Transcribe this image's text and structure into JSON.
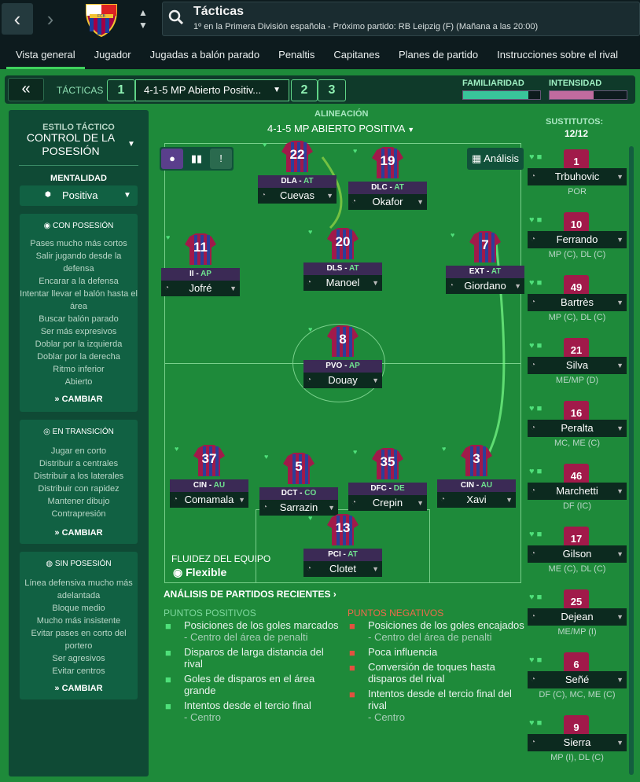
{
  "topbar": {
    "back": "‹",
    "forward": "›",
    "title": "Tácticas",
    "subtitle": "1º en la Primera División española - Próximo partido: RB Leipzig (F) (Mañana a las 20:00)",
    "crest_text": "FCB"
  },
  "tabs": [
    "Vista general",
    "Jugador",
    "Jugadas a balón parado",
    "Penaltis",
    "Capitanes",
    "Planes de partido",
    "Instrucciones sobre el rival"
  ],
  "tactic_header": {
    "collapse": "«",
    "label": "TÁCTICAS",
    "slots": [
      "1",
      "2",
      "3"
    ],
    "selected": "4-1-5 MP Abierto Positiv...",
    "familiaridad": "FAMILIARIDAD",
    "familiaridad_level": 0.85,
    "intensidad": "INTENSIDAD",
    "intensidad_level": 0.57
  },
  "left_panel": {
    "estilo_label": "ESTILO TÁCTICO",
    "estilo_value": "CONTROL DE LA POSESIÓN",
    "mentalidad_label": "MENTALIDAD",
    "mentalidad_value": "Positiva",
    "con_posesion": {
      "title": "CON POSESIÓN",
      "items": [
        "Pases mucho más cortos",
        "Salir jugando desde la defensa",
        "Encarar a la defensa",
        "Intentar llevar el balón hasta el área",
        "Buscar balón parado",
        "Ser más expresivos",
        "Doblar por la izquierda",
        "Doblar por la derecha",
        "Ritmo inferior",
        "Abierto"
      ],
      "button": "CAMBIAR"
    },
    "en_transicion": {
      "title": "EN TRANSICIÓN",
      "items": [
        "Jugar en corto",
        "Distribuir a centrales",
        "Distribuir a los laterales",
        "Distribuir con rapidez",
        "Mantener dibujo",
        "Contrapresión"
      ],
      "button": "CAMBIAR"
    },
    "sin_posesion": {
      "title": "SIN POSESIÓN",
      "items": [
        "Línea defensiva mucho más adelantada",
        "Bloque medio",
        "Mucho más insistente",
        "Evitar pases en corto del portero",
        "Ser agresivos",
        "Evitar centros"
      ],
      "button": "CAMBIAR"
    }
  },
  "pitch": {
    "alineacion": "ALINEACIÓN",
    "formation": "4-1-5 MP ABIERTO POSITIVA",
    "analisis": "Análisis",
    "players": [
      {
        "num": "22",
        "pos": "DLA",
        "duty": "AT",
        "name": "Cuevas"
      },
      {
        "num": "19",
        "pos": "DLC",
        "duty": "AT",
        "name": "Okafor"
      },
      {
        "num": "11",
        "pos": "II",
        "duty": "AP",
        "name": "Jofré"
      },
      {
        "num": "20",
        "pos": "DLS",
        "duty": "AT",
        "name": "Manoel"
      },
      {
        "num": "7",
        "pos": "EXT",
        "duty": "AT",
        "name": "Giordano"
      },
      {
        "num": "8",
        "pos": "PVO",
        "duty": "AP",
        "name": "Douay"
      },
      {
        "num": "37",
        "pos": "CIN",
        "duty": "AU",
        "name": "Comamala"
      },
      {
        "num": "5",
        "pos": "DCT",
        "duty": "CO",
        "name": "Sarrazin"
      },
      {
        "num": "35",
        "pos": "DFC",
        "duty": "DE",
        "name": "Crepin"
      },
      {
        "num": "3",
        "pos": "CIN",
        "duty": "AU",
        "name": "Xavi"
      },
      {
        "num": "13",
        "pos": "PCI",
        "duty": "AT",
        "name": "Clotet"
      }
    ],
    "fluidez_label": "FLUIDEZ DEL EQUIPO",
    "fluidez_value": "Flexible"
  },
  "analysis": {
    "title": "ANÁLISIS DE PARTIDOS RECIENTES",
    "positivos_label": "PUNTOS POSITIVOS",
    "positivos": [
      {
        "text": "Posiciones de los goles marcados",
        "sub": "- Centro del área de penalti"
      },
      {
        "text": "Disparos de larga distancia del rival",
        "sub": ""
      },
      {
        "text": "Goles de disparos en el área grande",
        "sub": ""
      },
      {
        "text": "Intentos desde el tercio final",
        "sub": "- Centro"
      }
    ],
    "negativos_label": "PUNTOS NEGATIVOS",
    "negativos": [
      {
        "text": "Posiciones de los goles encajados",
        "sub": "- Centro del área de penalti"
      },
      {
        "text": "Poca influencia",
        "sub": ""
      },
      {
        "text": "Conversión de toques hasta disparos del rival",
        "sub": ""
      },
      {
        "text": "Intentos desde el tercio final del rival",
        "sub": "- Centro"
      }
    ]
  },
  "subs": {
    "title": "SUSTITUTOS:",
    "count": "12/12",
    "players": [
      {
        "num": "1",
        "name": "Trbuhovic",
        "pos": "POR"
      },
      {
        "num": "10",
        "name": "Ferrando",
        "pos": "MP (C), DL (C)"
      },
      {
        "num": "49",
        "name": "Bartrès",
        "pos": "MP (C), DL (C)"
      },
      {
        "num": "21",
        "name": "Silva",
        "pos": "ME/MP (D)"
      },
      {
        "num": "16",
        "name": "Peralta",
        "pos": "MC, ME (C)"
      },
      {
        "num": "46",
        "name": "Marchetti",
        "pos": "DF (IC)"
      },
      {
        "num": "17",
        "name": "Gilson",
        "pos": "ME (C), DL (C)"
      },
      {
        "num": "25",
        "name": "Dejean",
        "pos": "ME/MP (I)"
      },
      {
        "num": "6",
        "name": "Señé",
        "pos": "DF (C), MC, ME (C)"
      },
      {
        "num": "9",
        "name": "Sierra",
        "pos": "MP (I), DL (C)"
      }
    ]
  },
  "colors": {
    "pitch": "#1e8a3a",
    "accent": "#3fd25d",
    "dark": "#0d1b1e"
  }
}
